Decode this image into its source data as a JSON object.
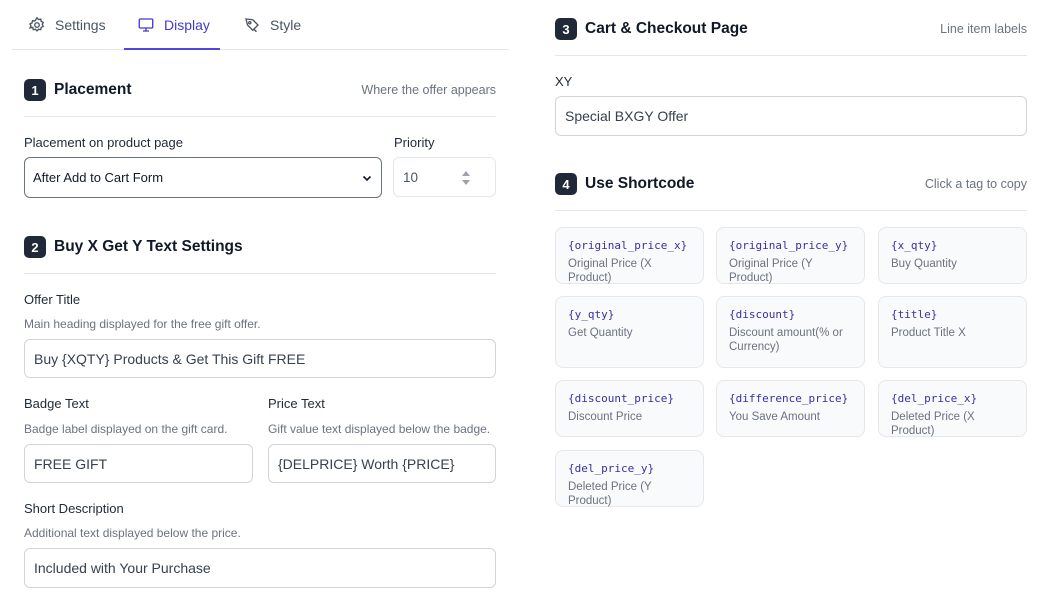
{
  "tabs": [
    {
      "label": "Settings",
      "icon": "gear-icon"
    },
    {
      "label": "Display",
      "icon": "monitor-icon"
    },
    {
      "label": "Style",
      "icon": "paint-icon"
    }
  ],
  "active_tab": "Display",
  "colors": {
    "accent": "#4f46e5",
    "badge": "#1f2937",
    "code": "#3730a3"
  },
  "placement": {
    "num": "1",
    "title": "Placement",
    "hint": "Where the offer appears",
    "product_page_label": "Placement on product page",
    "product_page_value": "After Add to Cart Form",
    "priority_label": "Priority",
    "priority_value": "10"
  },
  "bxgy": {
    "num": "2",
    "title": "Buy X Get Y Text Settings",
    "offer_title_label": "Offer Title",
    "offer_title_help": "Main heading displayed for the free gift offer.",
    "offer_title_value": "Buy {XQTY} Products & Get This Gift FREE",
    "badge_label": "Badge Text",
    "badge_help": "Badge label displayed on the gift card.",
    "badge_value": "FREE GIFT",
    "price_label": "Price Text",
    "price_help": "Gift value text displayed below the badge.",
    "price_value": "{DELPRICE} Worth {PRICE}",
    "short_desc_label": "Short Description",
    "short_desc_help": "Additional text displayed below the price.",
    "short_desc_value": "Included with Your Purchase"
  },
  "cart": {
    "num": "3",
    "title": "Cart & Checkout Page",
    "hint": "Line item labels",
    "field_label": "XY",
    "field_value": "Special BXGY Offer"
  },
  "shortcode": {
    "num": "4",
    "title": "Use Shortcode",
    "hint": "Click a tag to copy",
    "tags": [
      {
        "code": "{original_price_x}",
        "desc": "Original Price (X Product)"
      },
      {
        "code": "{original_price_y}",
        "desc": "Original Price (Y Product)"
      },
      {
        "code": "{x_qty}",
        "desc": "Buy Quantity"
      },
      {
        "code": "{y_qty}",
        "desc": "Get Quantity"
      },
      {
        "code": "{discount}",
        "desc": "Discount amount(% or Currency)"
      },
      {
        "code": "{title}",
        "desc": "Product Title X"
      },
      {
        "code": "{discount_price}",
        "desc": "Discount Price"
      },
      {
        "code": "{difference_price}",
        "desc": "You Save Amount"
      },
      {
        "code": "{del_price_x}",
        "desc": "Deleted Price (X Product)"
      },
      {
        "code": "{del_price_y}",
        "desc": "Deleted Price (Y Product)"
      }
    ]
  }
}
